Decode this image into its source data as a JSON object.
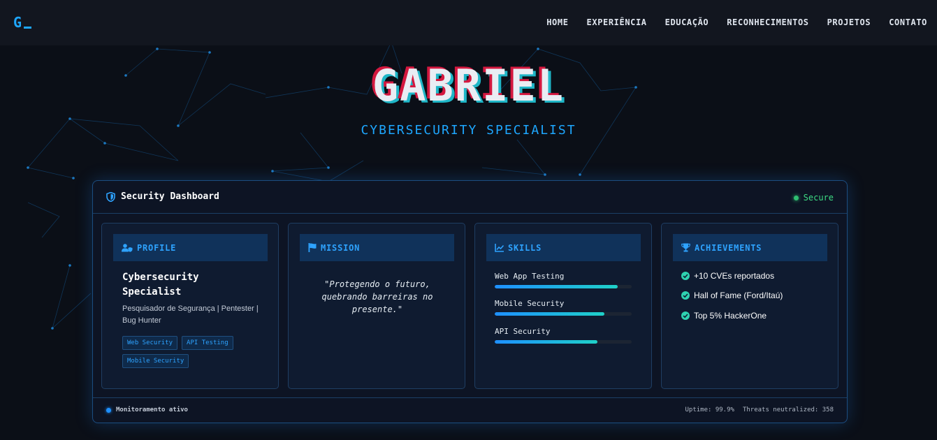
{
  "nav": {
    "logo": "G",
    "links": [
      "HOME",
      "EXPERIÊNCIA",
      "EDUCAÇÃO",
      "RECONHECIMENTOS",
      "PROJETOS",
      "CONTATO"
    ]
  },
  "hero": {
    "title": "GABRIEL",
    "subtitle": "CYBERSECURITY SPECIALIST"
  },
  "dashboard": {
    "title": "Security Dashboard",
    "status": "Secure",
    "profile": {
      "header": "PROFILE",
      "title": "Cybersecurity Specialist",
      "description": "Pesquisador de Segurança | Pentester | Bug Hunter",
      "tags": [
        "Web Security",
        "API Testing",
        "Mobile Security"
      ]
    },
    "mission": {
      "header": "MISSION",
      "quote": "\"Protegendo o futuro, quebrando barreiras no presente.\""
    },
    "skills": {
      "header": "SKILLS",
      "items": [
        {
          "name": "Web App Testing",
          "level": 0.9
        },
        {
          "name": "Mobile Security",
          "level": 0.8
        },
        {
          "name": "API Security",
          "level": 0.75
        }
      ]
    },
    "achievements": {
      "header": "ACHIEVEMENTS",
      "items": [
        "+10 CVEs reportados",
        "Hall of Fame (Ford/Itaú)",
        "Top 5% HackerOne"
      ]
    },
    "footer": {
      "monitoring": "Monitoramento ativo",
      "uptime": "Uptime: 99.9%",
      "threats": "Threats neutralized: 358"
    }
  },
  "colors": {
    "accent": "#1ea7ff",
    "secure": "#3ddc84",
    "glitch_red": "#d4183f",
    "glitch_cyan": "#1fb6c7"
  }
}
